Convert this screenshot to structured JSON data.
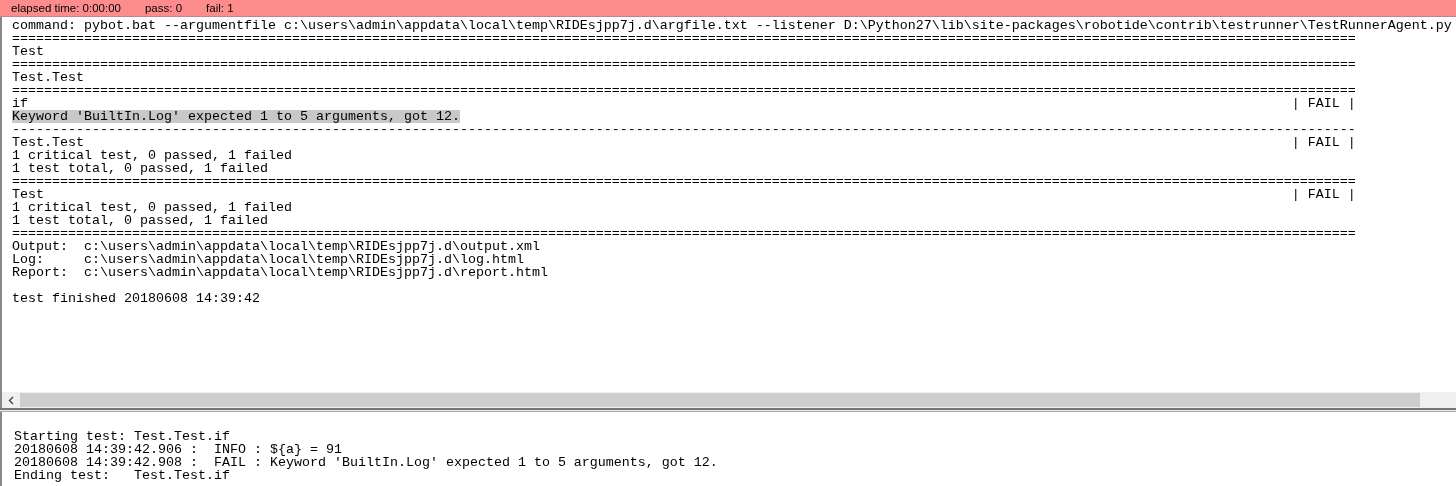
{
  "status_bar": {
    "elapsed": "elapsed time: 0:00:00",
    "pass": "pass: 0",
    "fail": "fail: 1"
  },
  "console": [
    {
      "kind": "text",
      "text": "command: pybot.bat --argumentfile c:\\users\\admin\\appdata\\local\\temp\\RIDEsjpp7j.d\\argfile.txt --listener D:\\Python27\\lib\\site-packages\\robotide\\contrib\\testrunner\\TestRunnerAgent.py"
    },
    {
      "kind": "separator",
      "text": "========================================================================================================================================================================"
    },
    {
      "kind": "text",
      "text": "Test"
    },
    {
      "kind": "separator",
      "text": "========================================================================================================================================================================"
    },
    {
      "kind": "text",
      "text": "Test.Test"
    },
    {
      "kind": "separator",
      "text": "========================================================================================================================================================================"
    },
    {
      "kind": "result",
      "text": "if",
      "status": "| FAIL |"
    },
    {
      "kind": "highlight",
      "text": "Keyword 'BuiltIn.Log' expected 1 to 5 arguments, got 12."
    },
    {
      "kind": "separator",
      "text": "------------------------------------------------------------------------------------------------------------------------------------------------------------------------"
    },
    {
      "kind": "result",
      "text": "Test.Test",
      "status": "| FAIL |"
    },
    {
      "kind": "text",
      "text": "1 critical test, 0 passed, 1 failed"
    },
    {
      "kind": "text",
      "text": "1 test total, 0 passed, 1 failed"
    },
    {
      "kind": "separator",
      "text": "========================================================================================================================================================================"
    },
    {
      "kind": "result",
      "text": "Test",
      "status": "| FAIL |"
    },
    {
      "kind": "text",
      "text": "1 critical test, 0 passed, 1 failed"
    },
    {
      "kind": "text",
      "text": "1 test total, 0 passed, 1 failed"
    },
    {
      "kind": "separator",
      "text": "========================================================================================================================================================================"
    },
    {
      "kind": "text",
      "text": "Output:  c:\\users\\admin\\appdata\\local\\temp\\RIDEsjpp7j.d\\output.xml"
    },
    {
      "kind": "text",
      "text": "Log:     c:\\users\\admin\\appdata\\local\\temp\\RIDEsjpp7j.d\\log.html"
    },
    {
      "kind": "text",
      "text": "Report:  c:\\users\\admin\\appdata\\local\\temp\\RIDEsjpp7j.d\\report.html"
    },
    {
      "kind": "footer",
      "text": "test finished 20180608 14:39:42"
    }
  ],
  "log": [
    "Starting test: Test.Test.if",
    "20180608 14:39:42.906 :  INFO : ${a} = 91",
    "20180608 14:39:42.908 :  FAIL : Keyword 'BuiltIn.Log' expected 1 to 5 arguments, got 12.",
    "Ending test:   Test.Test.if"
  ]
}
